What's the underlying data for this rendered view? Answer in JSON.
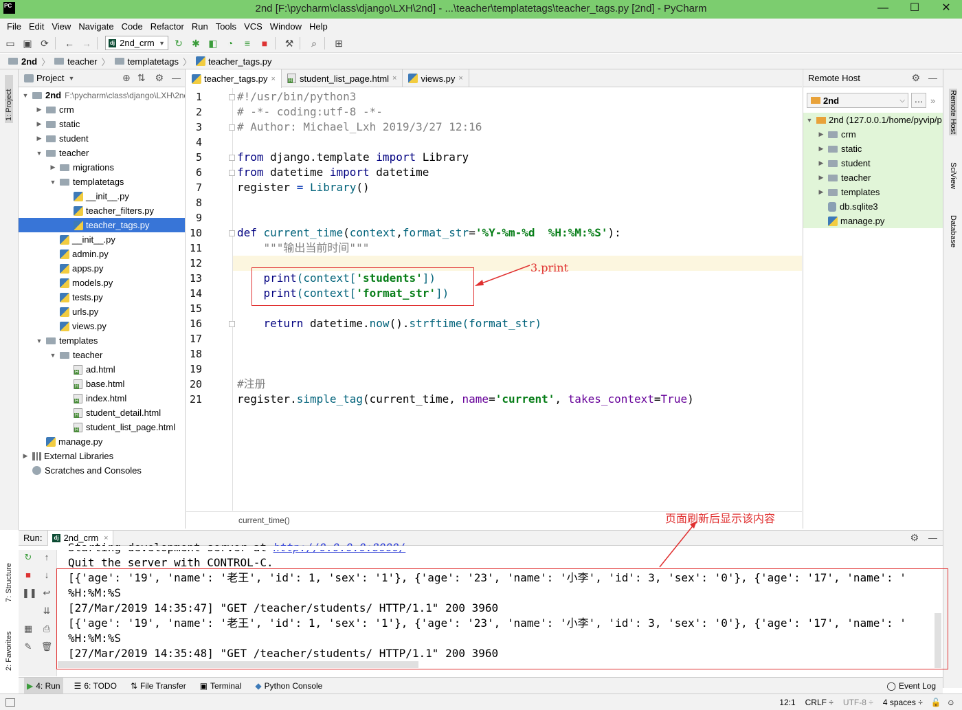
{
  "window": {
    "title": "2nd [F:\\pycharm\\class\\django\\LXH\\2nd] - ...\\teacher\\templatetags\\teacher_tags.py [2nd] - PyCharm",
    "logo": "PC"
  },
  "menu": [
    "File",
    "Edit",
    "View",
    "Navigate",
    "Code",
    "Refactor",
    "Run",
    "Tools",
    "VCS",
    "Window",
    "Help"
  ],
  "toolbar": {
    "run_config": "2nd_crm",
    "run_config_badge": "dj"
  },
  "breadcrumb": [
    "2nd",
    "teacher",
    "templatetags",
    "teacher_tags.py"
  ],
  "left_strip": {
    "project_tab": "1: Project",
    "structure_tab": "7: Structure",
    "favorites_tab": "2: Favorites"
  },
  "project": {
    "header": "Project",
    "root_name": "2nd",
    "root_path": "F:\\pycharm\\class\\django\\LXH\\2nd",
    "items": [
      {
        "label": "crm",
        "type": "folder",
        "arrow": "▶"
      },
      {
        "label": "static",
        "type": "folder",
        "arrow": "▶"
      },
      {
        "label": "student",
        "type": "folder",
        "arrow": "▶"
      },
      {
        "label": "teacher",
        "type": "folder",
        "arrow": "▼"
      },
      {
        "label": "migrations",
        "type": "folder",
        "arrow": "▶"
      },
      {
        "label": "templatetags",
        "type": "folder",
        "arrow": "▼"
      },
      {
        "label": "__init__.py",
        "type": "py"
      },
      {
        "label": "teacher_filters.py",
        "type": "py"
      },
      {
        "label": "teacher_tags.py",
        "type": "py"
      },
      {
        "label": "__init__.py",
        "type": "py"
      },
      {
        "label": "admin.py",
        "type": "py"
      },
      {
        "label": "apps.py",
        "type": "py"
      },
      {
        "label": "models.py",
        "type": "py"
      },
      {
        "label": "tests.py",
        "type": "py"
      },
      {
        "label": "urls.py",
        "type": "py"
      },
      {
        "label": "views.py",
        "type": "py"
      },
      {
        "label": "templates",
        "type": "folder",
        "arrow": "▼"
      },
      {
        "label": "teacher",
        "type": "folder",
        "arrow": "▼"
      },
      {
        "label": "ad.html",
        "type": "html"
      },
      {
        "label": "base.html",
        "type": "html"
      },
      {
        "label": "index.html",
        "type": "html"
      },
      {
        "label": "student_detail.html",
        "type": "html"
      },
      {
        "label": "student_list_page.html",
        "type": "html"
      },
      {
        "label": "manage.py",
        "type": "py"
      },
      {
        "label": "External Libraries",
        "type": "lib",
        "arrow": "▶"
      },
      {
        "label": "Scratches and Consoles",
        "type": "scratch"
      }
    ]
  },
  "editor": {
    "tabs": [
      "teacher_tags.py",
      "student_list_page.html",
      "views.py"
    ],
    "line_numbers": [
      "1",
      "2",
      "3",
      "4",
      "5",
      "6",
      "7",
      "8",
      "9",
      "10",
      "11",
      "12",
      "13",
      "14",
      "15",
      "16",
      "17",
      "18",
      "19",
      "20",
      "21"
    ],
    "code": {
      "l1": "#!/usr/bin/python3",
      "l2": "# -*- coding:utf-8 -*-",
      "l3": "# Author: Michael_Lxh 2019/3/27 12:16",
      "l5a": "from",
      "l5b": " django.template ",
      "l5c": "import",
      "l5d": " Library",
      "l6a": "from",
      "l6b": " datetime ",
      "l6c": "import",
      "l6d": " datetime",
      "l7a": "register ",
      "l7b": "=",
      "l7c": " ",
      "l7d": "Library",
      "l7e": "()",
      "l10a": "def",
      "l10b": " current_time",
      "l10c": "(",
      "l10d": "context",
      "l10e": ",",
      "l10f": "format_str",
      "l10g": "=",
      "l10h": "'%Y-%m-%d  %H:%M:%S'",
      "l10i": "):",
      "l11": "    \"\"\"输出当前时间\"\"\"",
      "l13a": "    ",
      "l13b": "print",
      "l13c": "(context[",
      "l13d": "'students'",
      "l13e": "])",
      "l14a": "    ",
      "l14b": "print",
      "l14c": "(context[",
      "l14d": "'format_str'",
      "l14e": "])",
      "l16a": "    ",
      "l16b": "return",
      "l16c": " datetime.",
      "l16d": "now",
      "l16e": "().",
      "l16f": "strftime",
      "l16g": "(format_str)",
      "l20": "#注册",
      "l21a": "register.",
      "l21b": "simple_tag",
      "l21c": "(current_time, ",
      "l21d": "name",
      "l21e": "=",
      "l21f": "'current'",
      "l21g": ", ",
      "l21h": "takes_context",
      "l21i": "=",
      "l21j": "True",
      "l21k": ")"
    },
    "annotation": "3.print",
    "footer_breadcrumb": "current_time()"
  },
  "remote_host": {
    "header": "Remote Host",
    "server": "2nd",
    "root": "2nd (127.0.0.1/home/pyvip/p",
    "items": [
      {
        "label": "crm",
        "type": "folder",
        "arrow": "▶"
      },
      {
        "label": "static",
        "type": "folder",
        "arrow": "▶"
      },
      {
        "label": "student",
        "type": "folder",
        "arrow": "▶"
      },
      {
        "label": "teacher",
        "type": "folder",
        "arrow": "▶"
      },
      {
        "label": "templates",
        "type": "folder",
        "arrow": "▶"
      },
      {
        "label": "db.sqlite3",
        "type": "db"
      },
      {
        "label": "manage.py",
        "type": "py"
      }
    ]
  },
  "right_strip": {
    "remote_tab": "Remote Host",
    "sciview_tab": "SciView",
    "database_tab": "Database"
  },
  "run": {
    "label": "Run:",
    "config": "2nd_crm",
    "annotation": "页面刷新后显示该内容",
    "lines": {
      "l0a": "Starting development server at ",
      "l0b": "http://0.0.0.0:8000/",
      "l1": "Quit the server with CONTROL-C.",
      "l2": "[{'age': '19', 'name': '老王', 'id': 1, 'sex': '1'}, {'age': '23', 'name': '小李', 'id': 3, 'sex': '0'}, {'age': '17', 'name': '",
      "l3": "%H:%M:%S",
      "l4": "[27/Mar/2019 14:35:47] \"GET /teacher/students/ HTTP/1.1\" 200 3960",
      "l5": "[{'age': '19', 'name': '老王', 'id': 1, 'sex': '1'}, {'age': '23', 'name': '小李', 'id': 3, 'sex': '0'}, {'age': '17', 'name': '",
      "l6": "%H:%M:%S",
      "l7": "[27/Mar/2019 14:35:48] \"GET /teacher/students/ HTTP/1.1\" 200 3960"
    }
  },
  "bottom_tabs": [
    "4: Run",
    "6: TODO",
    "File Transfer",
    "Terminal",
    "Python Console"
  ],
  "status": {
    "event_log": "Event Log",
    "position": "12:1",
    "line_sep": "CRLF ÷",
    "encoding": "UTF-8 ÷",
    "indent": "4 spaces ÷"
  },
  "colors": {
    "title_green": "#7ccd6f",
    "selection": "#3875d7",
    "annotation_red": "#e03030",
    "remote_bg": "#e1f5d8"
  }
}
